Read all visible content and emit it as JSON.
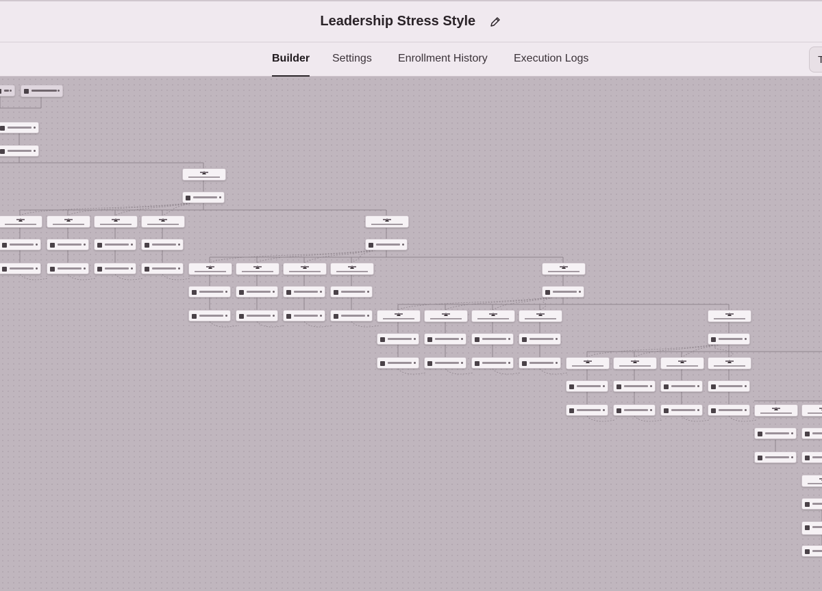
{
  "header": {
    "title": "Leadership Stress Style",
    "edit_icon": "pencil-icon"
  },
  "tabs": [
    {
      "label": "Builder",
      "active": true
    },
    {
      "label": "Settings",
      "active": false
    },
    {
      "label": "Enrollment History",
      "active": false
    },
    {
      "label": "Execution Logs",
      "active": false
    }
  ],
  "corner_button": {
    "label": "T"
  },
  "colors": {
    "canvas": "#c2b8c0",
    "header_bg": "#f0e9ef",
    "node_bg": "#f6f2f5",
    "edge": "#8f858d"
  }
}
